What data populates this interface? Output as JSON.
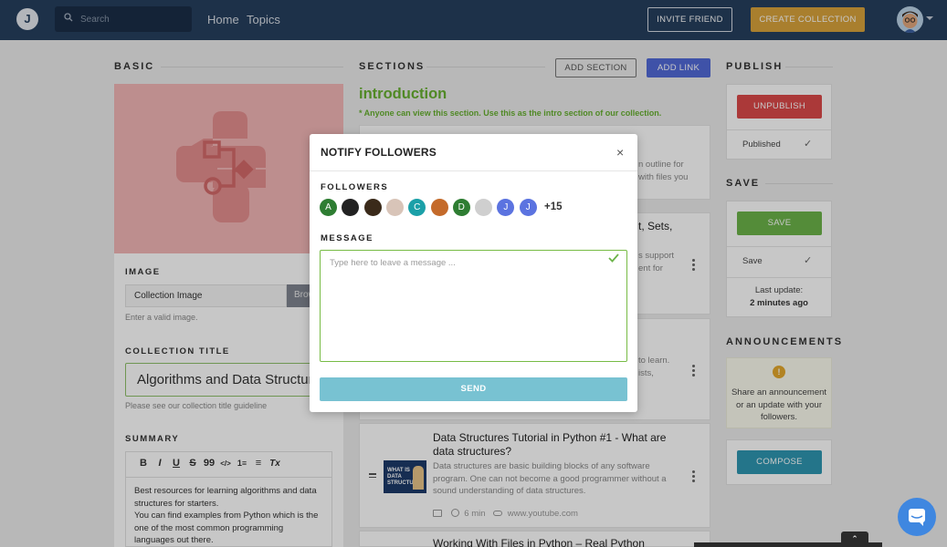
{
  "nav": {
    "logo": "J",
    "search_placeholder": "Search",
    "links": [
      "Home",
      "Topics"
    ],
    "invite_label": "INVITE FRIEND",
    "create_label": "CREATE COLLECTION"
  },
  "basic": {
    "header": "BASIC",
    "image_label": "IMAGE",
    "image_value": "Collection Image",
    "browse_label": "Browse",
    "image_help": "Enter a valid image.",
    "title_label": "COLLECTION TITLE",
    "title_value": "Algorithms and Data Structures",
    "title_help": "Please see our collection title guideline",
    "summary_label": "SUMMARY",
    "toolbar": [
      "B",
      "I",
      "U",
      "S",
      "99",
      "</>",
      "1≡",
      "≡",
      "Tx"
    ],
    "summary_lines": [
      "Best resources for learning algorithms and data structures for starters.",
      "You can find examples from Python which is the one of the most common programming languages out there."
    ]
  },
  "sections": {
    "header": "SECTIONS",
    "add_section_label": "ADD SECTION",
    "add_link_label": "ADD LINK",
    "intro_title": "introduction",
    "intro_note": "* Anyone can view this section. Use this as the intro section of our collection.",
    "card1_lines": [
      "n outline for",
      "with files  you"
    ],
    "card2_title_frag": "t, Sets,",
    "card2_lines": [
      "s support",
      "ent for"
    ],
    "card3_lines": [
      "to learn.",
      "ists,"
    ],
    "item": {
      "title": "Data Structures Tutorial in Python #1 - What are data structures?",
      "description": "Data structures are basic building blocks of any software program. One can not become a good programmer without a sound understanding of data structures.",
      "duration": "6 min",
      "domain": "www.youtube.com",
      "thumb_text": "WHAT IS DATA STRUCTURE"
    },
    "next_title": "Working With Files in Python – Real Python"
  },
  "publish": {
    "header": "PUBLISH",
    "unpublish_label": "UNPUBLISH",
    "status": "Published"
  },
  "save": {
    "header": "SAVE",
    "save_label": "SAVE",
    "status": "Save",
    "last_update_label": "Last update:",
    "last_update_value": "2 minutes ago"
  },
  "announcements": {
    "header": "ANNOUNCEMENTS",
    "text": "Share an announcement or an update with your followers.",
    "compose_label": "COMPOSE"
  },
  "modal": {
    "title": "NOTIFY FOLLOWERS",
    "followers_label": "FOLLOWERS",
    "followers": [
      {
        "initial": "A",
        "color": "#2e7d32"
      },
      {
        "initial": "",
        "color": "#222222"
      },
      {
        "initial": "",
        "color": "#3a2a1a"
      },
      {
        "initial": "",
        "color": "#d8c4b8"
      },
      {
        "initial": "C",
        "color": "#1ba0a8"
      },
      {
        "initial": "",
        "color": "#c46a2a"
      },
      {
        "initial": "D",
        "color": "#2e7d32"
      },
      {
        "initial": "",
        "color": "#cfcfcf"
      },
      {
        "initial": "J",
        "color": "#5b73e0"
      },
      {
        "initial": "J",
        "color": "#5b73e0"
      }
    ],
    "more_count": "+15",
    "message_label": "MESSAGE",
    "message_placeholder": "Type here to leave a message ...",
    "send_label": "SEND"
  },
  "colors": {
    "nav_bg": "#263f5e",
    "accent_green": "#67b030",
    "danger": "#dc4a4a",
    "create": "#d9a33c",
    "link_blue": "#5169d8"
  }
}
